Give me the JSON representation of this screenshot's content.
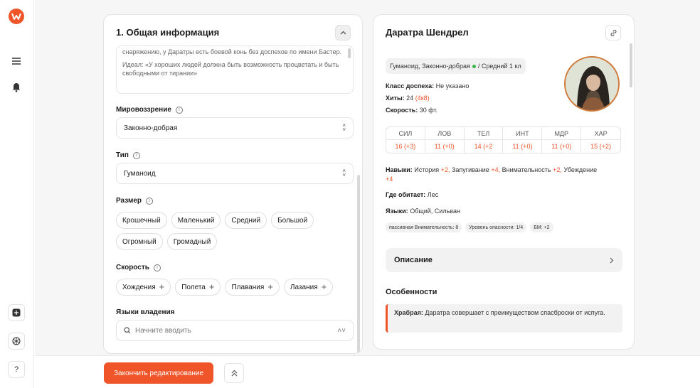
{
  "colors": {
    "accent": "#f0552a",
    "positive": "#3bb34a"
  },
  "sidebar": {
    "icons": [
      "logo-icon",
      "menu-icon",
      "bell-icon",
      "add-icon",
      "settings-icon",
      "help-icon"
    ],
    "help_label": "?"
  },
  "editor": {
    "section_title": "1. Общая информация",
    "textarea": {
      "line1": "снаряжению, у Даратры есть боевой конь без доспехов по имени Бастер.",
      "line2": "Идеал: «У хороших людей должна быть возможность процветать и быть свободными от тирании»"
    },
    "alignment": {
      "label": "Мировоззрение",
      "value": "Законно-добрая"
    },
    "type": {
      "label": "Тип",
      "value": "Гуманоид"
    },
    "size": {
      "label": "Размер",
      "options": [
        "Крошечный",
        "Маленький",
        "Средний",
        "Большой",
        "Огромный",
        "Громадный"
      ]
    },
    "speed": {
      "label": "Скорость",
      "options": [
        "Хождения",
        "Полета",
        "Плавания",
        "Лазания"
      ]
    },
    "languages": {
      "label": "Языки владения",
      "placeholder": "Начните вводить"
    }
  },
  "card": {
    "name": "Даратра Шендрел",
    "type_line_a": "Гуманоид, Законно-добрая",
    "type_line_b": "/ Средний 1 кл",
    "armor_label": "Класс доспеха:",
    "armor_value": "Не указано",
    "hp_label": "Хиты:",
    "hp_value": "24",
    "hp_dice": "(4к8)",
    "speed_label": "Скорость:",
    "speed_value": "30 фт.",
    "abilities": [
      {
        "name": "СИЛ",
        "value": "16 (+3)"
      },
      {
        "name": "ЛОВ",
        "value": "11 (+0)"
      },
      {
        "name": "ТЕЛ",
        "value": "14 (+2"
      },
      {
        "name": "ИНТ",
        "value": "11 (+0)"
      },
      {
        "name": "МДР",
        "value": "11 (+0)"
      },
      {
        "name": "ХАР",
        "value": "15 (+2)"
      }
    ],
    "skills_label": "Навыки:",
    "skills": [
      {
        "name": "История",
        "bonus": "+2,"
      },
      {
        "name": "Запугивание",
        "bonus": "+4,"
      },
      {
        "name": "Внимательность",
        "bonus": "+2,"
      },
      {
        "name": "Убеждение",
        "bonus": "+4"
      }
    ],
    "habitat_label": "Где обитает:",
    "habitat_value": "Лес",
    "languages_label": "Языки:",
    "languages_value": "Общий, Сильван",
    "badges": [
      "пассивная Внимательность: 8",
      "Уровень опасности: 1/4",
      "БМ: +2"
    ],
    "description_label": "Описание",
    "features_title": "Особенности",
    "feature_name": "Храбрая:",
    "feature_text": "Даратра совершает с преимуществом спасброски от испуга."
  },
  "footer": {
    "finish_label": "Закончить редактирование"
  }
}
